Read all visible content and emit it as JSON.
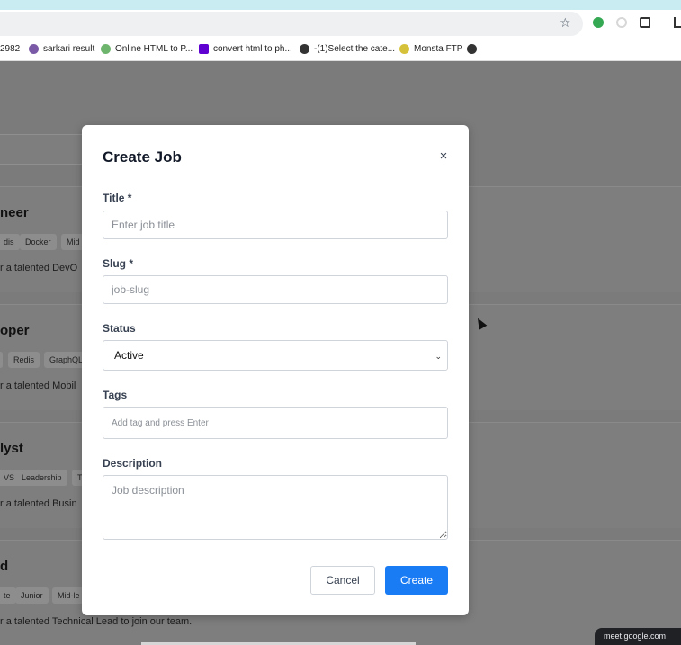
{
  "browser": {
    "bookmarks": [
      {
        "label": "2982",
        "icon": "none"
      },
      {
        "label": "sarkari result",
        "icon": "site-icon"
      },
      {
        "label": "Online HTML to P...",
        "icon": "site-icon"
      },
      {
        "label": "convert html to ph...",
        "icon": "yahoo-icon"
      },
      {
        "label": "-(1)Select the cate...",
        "icon": "globe-icon"
      },
      {
        "label": "Monsta FTP",
        "icon": "site-icon"
      },
      {
        "label": "",
        "icon": "globe-icon"
      }
    ],
    "meet_indicator": "meet.google.com"
  },
  "background": {
    "cards": [
      {
        "title": "neer",
        "tags": [
          "dis",
          "Docker",
          "Mid"
        ],
        "desc": "r a talented DevO"
      },
      {
        "title": "oper",
        "tags": [
          "",
          "Redis",
          "GraphQL"
        ],
        "desc": "r a talented Mobil"
      },
      {
        "title": "lyst",
        "tags": [
          "VS",
          "Leadership",
          "T"
        ],
        "desc": "r a talented Busin"
      },
      {
        "title": "d",
        "tags": [
          "te",
          "Junior",
          "Mid-le"
        ],
        "desc": "r a talented Technical Lead to join our team."
      }
    ]
  },
  "modal": {
    "title": "Create Job",
    "close_label": "×",
    "fields": {
      "title": {
        "label": "Title *",
        "placeholder": "Enter job title",
        "value": ""
      },
      "slug": {
        "label": "Slug *",
        "placeholder": "job-slug",
        "value": ""
      },
      "status": {
        "label": "Status",
        "selected": "Active"
      },
      "tags": {
        "label": "Tags",
        "placeholder": "Add tag and press Enter",
        "value": ""
      },
      "description": {
        "label": "Description",
        "placeholder": "Job description",
        "value": ""
      }
    },
    "cancel_label": "Cancel",
    "create_label": "Create",
    "accent_color": "#1a7cf5"
  }
}
